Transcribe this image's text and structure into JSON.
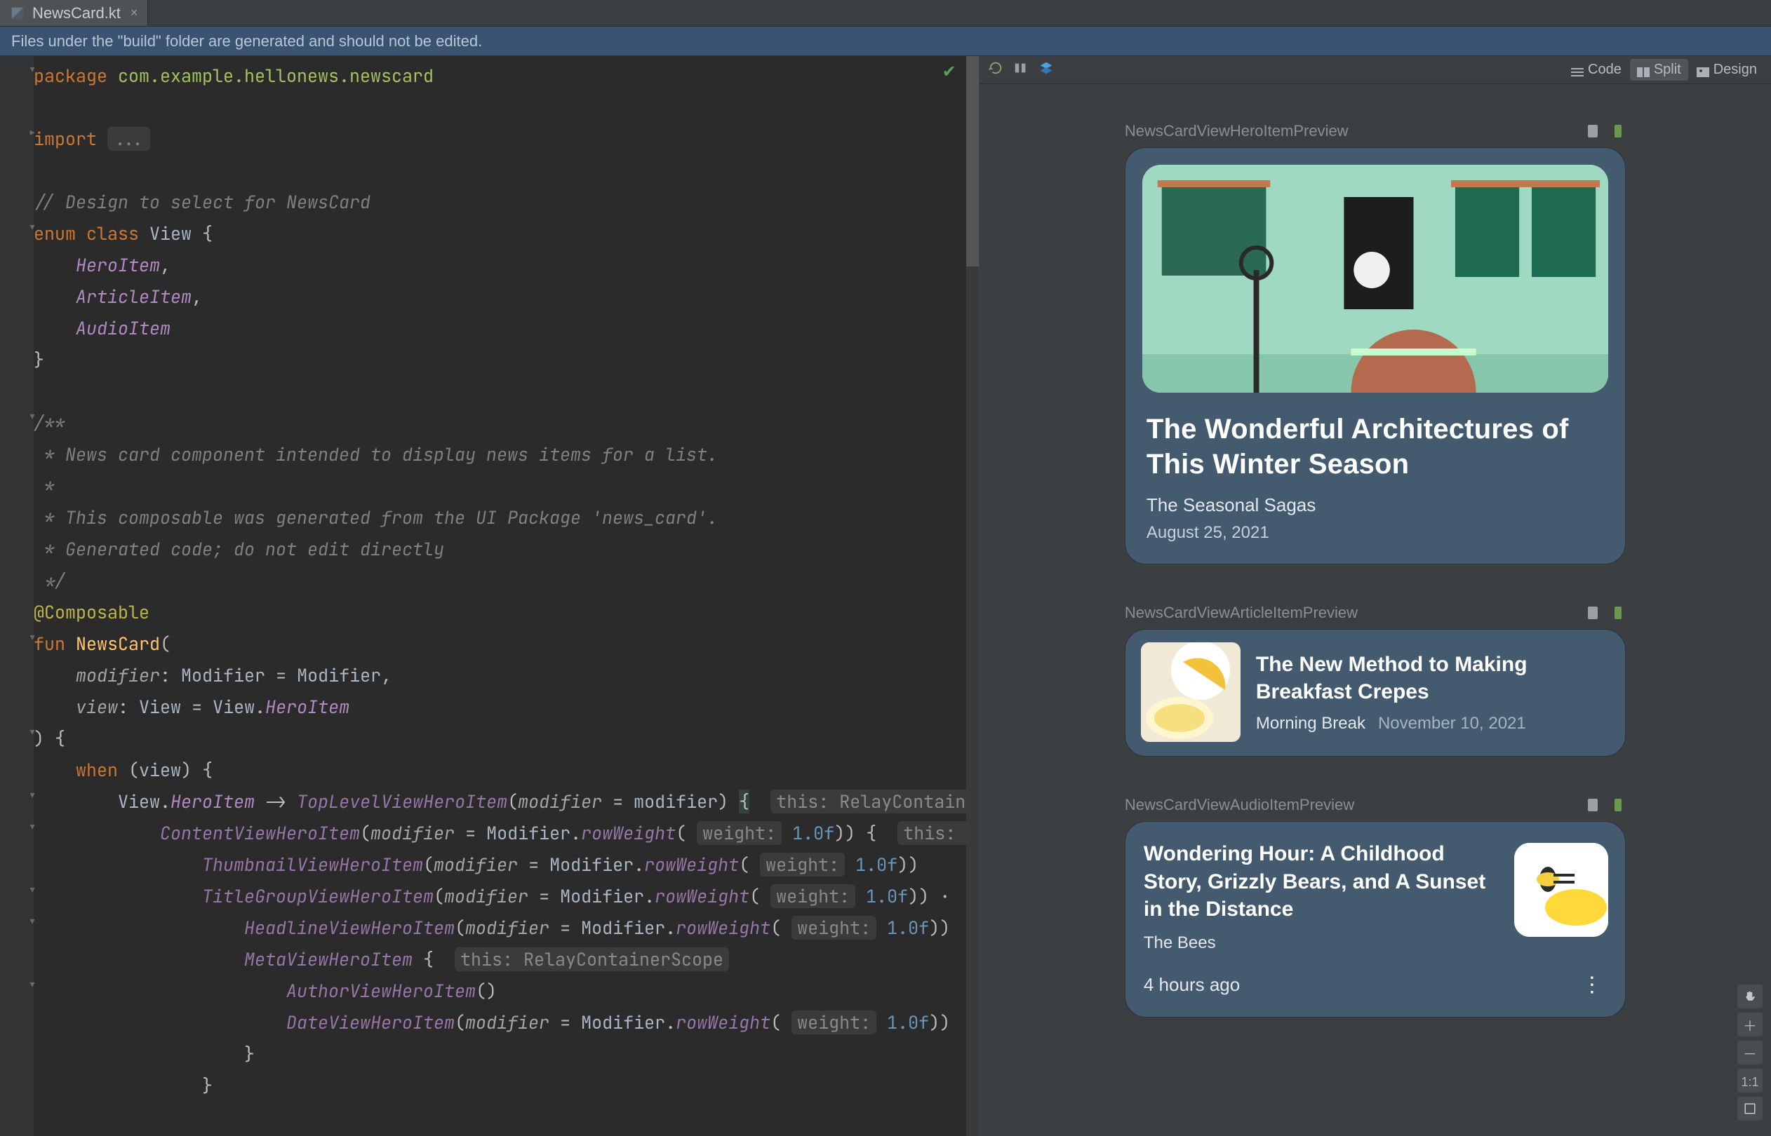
{
  "tab": {
    "filename": "NewsCard.kt"
  },
  "info_bar": "Files under the \"build\" folder are generated and should not be edited.",
  "view_modes": {
    "code": "Code",
    "split": "Split",
    "design": "Design",
    "selected": "split"
  },
  "code": {
    "package_kw": "package",
    "package_name": "com.example.hellonews.newscard",
    "import_kw": "import",
    "import_fold": "...",
    "design_comment": "// Design to select for NewsCard",
    "enum_kw": "enum class",
    "enum_name": "View",
    "enum_item0": "HeroItem",
    "enum_item1": "ArticleItem",
    "enum_item2": "AudioItem",
    "doc_l1": "/**",
    "doc_l2": " * News card component intended to display news items for a list.",
    "doc_l3": " *",
    "doc_l4": " * This composable was generated from the UI Package 'news_card'.",
    "doc_l5": " * Generated code; do not edit directly",
    "doc_l6": " */",
    "ann": "@Composable",
    "fun_kw": "fun",
    "fun_name": "NewsCard",
    "param1_name": "modifier",
    "param1_type": "Modifier",
    "param1_def": "Modifier",
    "param2_name": "view",
    "param2_type": "View",
    "param2_def_owner": "View",
    "param2_def_member": "HeroItem",
    "when_kw": "when",
    "when_arg": "view",
    "case1_owner": "View",
    "case1_member": "HeroItem",
    "fn_top": "TopLevelViewHeroItem",
    "arg_name": "modifier",
    "hint_this1": "this: RelayContain",
    "fn_content": "ContentViewHeroItem",
    "mod_call": "Modifier",
    "row_weight": "rowWeight",
    "hint_weight": "weight:",
    "val_1f": "1.0f",
    "hint_this2": "this: R",
    "fn_thumb": "ThumbnailViewHeroItem",
    "fn_titlegrp": "TitleGroupViewHeroItem",
    "fn_headline": "HeadlineViewHeroItem",
    "fn_meta": "MetaViewHeroItem",
    "hint_this3": "this: RelayContainerScope",
    "fn_author": "AuthorViewHeroItem",
    "fn_date": "DateViewHeroItem"
  },
  "previews": {
    "hero": {
      "label": "NewsCardViewHeroItemPreview",
      "headline": "The Wonderful Architectures of This Winter Season",
      "author": "The Seasonal Sagas",
      "date": "August 25, 2021"
    },
    "article": {
      "label": "NewsCardViewArticleItemPreview",
      "headline": "The New Method to Making Breakfast Crepes",
      "author": "Morning Break",
      "date": "November 10, 2021"
    },
    "audio": {
      "label": "NewsCardViewAudioItemPreview",
      "headline": "Wondering Hour: A Childhood Story, Grizzly Bears, and A Sunset in the Distance",
      "author": "The Bees",
      "time": "4 hours ago"
    }
  },
  "zoom": {
    "ratio": "1:1"
  }
}
